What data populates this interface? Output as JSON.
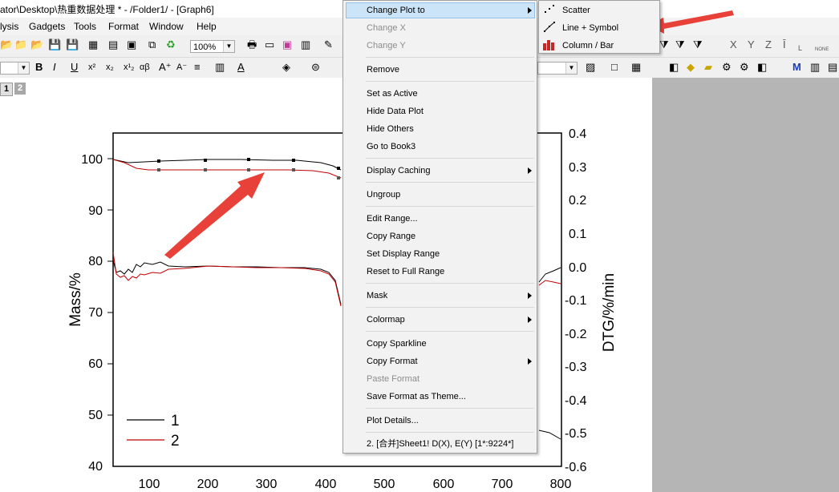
{
  "window": {
    "title": "ator\\Desktop\\热重数据处理 * - /Folder1/ - [Graph6]"
  },
  "menu": [
    "lysis",
    "Gadgets",
    "Tools",
    "Format",
    "Window",
    "Help"
  ],
  "toolbar": {
    "zoom": "100%"
  },
  "layers": [
    "1",
    "2"
  ],
  "graph": {
    "left_axis": {
      "label": "Mass/%",
      "ticks": [
        "100",
        "90",
        "80",
        "70",
        "60",
        "50",
        "40"
      ]
    },
    "right_axis": {
      "label": "DTG/%/min",
      "ticks": [
        "0.4",
        "0.3",
        "0.2",
        "0.1",
        "0.0",
        "-0.1",
        "-0.2",
        "-0.3",
        "-0.4",
        "-0.5",
        "-0.6"
      ]
    },
    "bottom_axis": {
      "ticks": [
        "100",
        "200",
        "300",
        "400",
        "500",
        "600",
        "700",
        "800"
      ]
    },
    "legend": [
      {
        "name": "1",
        "color": "#000000"
      },
      {
        "name": "2",
        "color": "#c00000"
      }
    ]
  },
  "context_menu": {
    "items": [
      {
        "label": "Change Plot to",
        "submenu": true,
        "highlight": true
      },
      {
        "label": "Change X",
        "disabled": true
      },
      {
        "label": "Change Y",
        "disabled": true
      },
      {
        "label": "Remove"
      },
      {
        "label": "Set as Active"
      },
      {
        "label": "Hide Data Plot"
      },
      {
        "label": "Hide Others"
      },
      {
        "label": "Go to Book3"
      },
      {
        "label": "Display Caching",
        "submenu": true
      },
      {
        "label": "Ungroup"
      },
      {
        "label": "Edit Range..."
      },
      {
        "label": "Copy Range"
      },
      {
        "label": "Set Display Range"
      },
      {
        "label": "Reset to Full Range"
      },
      {
        "label": "Mask",
        "submenu": true
      },
      {
        "label": "Colormap",
        "submenu": true
      },
      {
        "label": "Copy Sparkline"
      },
      {
        "label": "Copy Format",
        "submenu": true
      },
      {
        "label": "Paste Format",
        "disabled": true
      },
      {
        "label": "Save Format as Theme..."
      },
      {
        "label": "Plot Details..."
      },
      {
        "label": "2. [合并]Sheet1! D(X), E(Y) [1*:9224*]"
      }
    ]
  },
  "submenu": {
    "items": [
      "Scatter",
      "Line + Symbol",
      "Column / Bar"
    ]
  },
  "colors": {
    "arrow": "#e8413a",
    "series1": "#000000",
    "series2": "#c00000",
    "highlight": "#cce4f7"
  }
}
